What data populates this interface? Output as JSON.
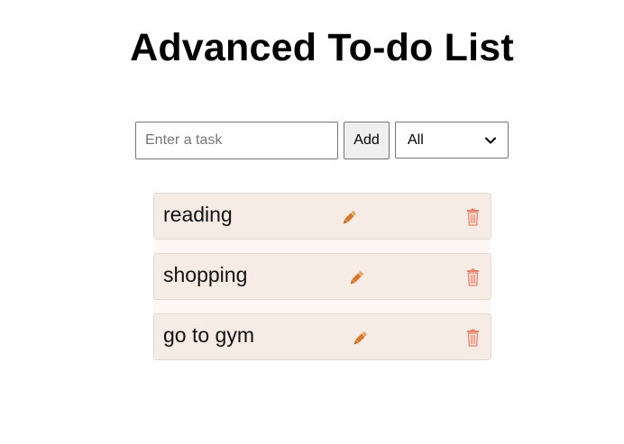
{
  "header": {
    "title": "Advanced To-do List"
  },
  "input": {
    "placeholder": "Enter a task",
    "value": ""
  },
  "add_button": {
    "label": "Add"
  },
  "filter": {
    "selected": "All"
  },
  "tasks": [
    {
      "text": "reading"
    },
    {
      "text": "shopping"
    },
    {
      "text": "go to gym"
    }
  ],
  "icons": {
    "edit": "pencil-icon",
    "delete": "trash-icon",
    "dropdown": "chevron-down-icon"
  },
  "colors": {
    "task_bg": "#f6ebe5",
    "task_border": "#e5d8d1",
    "edit_icon": "#d7772b",
    "delete_icon": "#e8806a"
  }
}
